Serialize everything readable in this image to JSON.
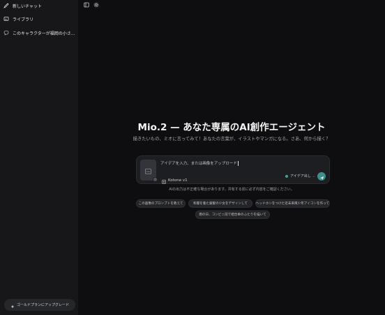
{
  "sidebar": {
    "items": [
      {
        "label": "新しいチャット",
        "icon": "new-chat-icon"
      },
      {
        "label": "ライブラリ",
        "icon": "library-icon"
      },
      {
        "label": "このキャラクターが福岡の小さ...",
        "icon": "chat-bubble-icon"
      }
    ],
    "upgrade_label": "ゴールドプランにアップグレード"
  },
  "main": {
    "title": "Mio.2 — あなた専属のAI創作エージェント",
    "subtitle": "描きたいもの、ミオに言ってみて！あなたの言葉が、イラストやマンガになる。さあ、何から描く？",
    "composer": {
      "placeholder": "アイデアを入力、または画像をアップロード",
      "model_label": "Kotone v1",
      "mode_label": "アイデア出し"
    },
    "disclaimer": "AIの出力は不正確な場合があります。共有する前に必ず内容をご確認ください。",
    "suggestions": [
      "この画像のプロンプトを教えて",
      "和服を着た銀髪の少女をデザインして",
      "ヘッドホンをつけた近未来風少年アイコンを作って",
      "雨の日、コンビニ前で相合傘のふたりを描いて"
    ]
  },
  "colors": {
    "background": "#0e0e10",
    "sidebar": "#171719",
    "accent": "#3e8f8a"
  }
}
